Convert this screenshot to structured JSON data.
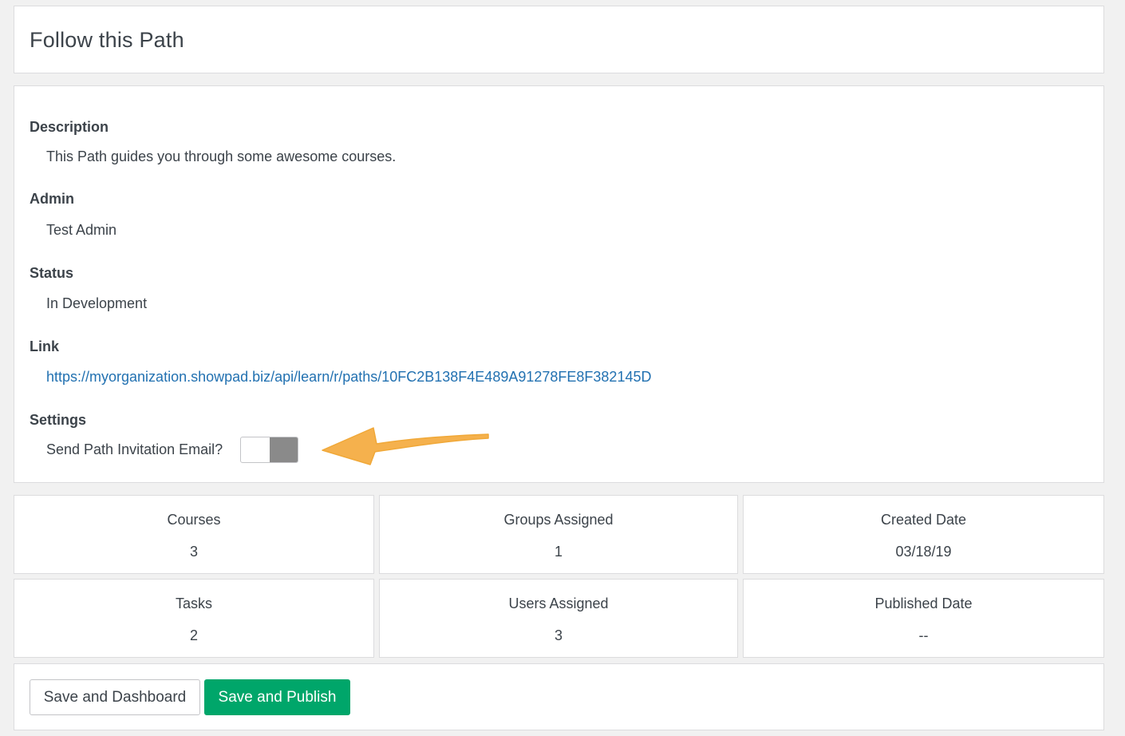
{
  "header": {
    "title": "Follow this Path"
  },
  "details": {
    "description_label": "Description",
    "description_value": "This Path guides you through some awesome courses.",
    "admin_label": "Admin",
    "admin_value": "Test Admin",
    "status_label": "Status",
    "status_value": "In Development",
    "link_label": "Link",
    "link_value": "https://myorganization.showpad.biz/api/learn/r/paths/10FC2B138F4E489A91278FE8F382145D",
    "settings_label": "Settings",
    "invitation_label": "Send Path Invitation Email?",
    "invitation_enabled": false
  },
  "stats": {
    "courses": {
      "label": "Courses",
      "value": "3"
    },
    "groups": {
      "label": "Groups Assigned",
      "value": "1"
    },
    "created": {
      "label": "Created Date",
      "value": "03/18/19"
    },
    "tasks": {
      "label": "Tasks",
      "value": "2"
    },
    "users": {
      "label": "Users Assigned",
      "value": "3"
    },
    "published": {
      "label": "Published Date",
      "value": "--"
    }
  },
  "actions": {
    "save_dashboard_label": "Save and Dashboard",
    "save_publish_label": "Save and Publish"
  },
  "colors": {
    "accent_green": "#00a66a",
    "link_blue": "#2271b1",
    "annotation_arrow": "#f5b14d"
  },
  "icons": {
    "annotation": "arrow-left-icon"
  }
}
